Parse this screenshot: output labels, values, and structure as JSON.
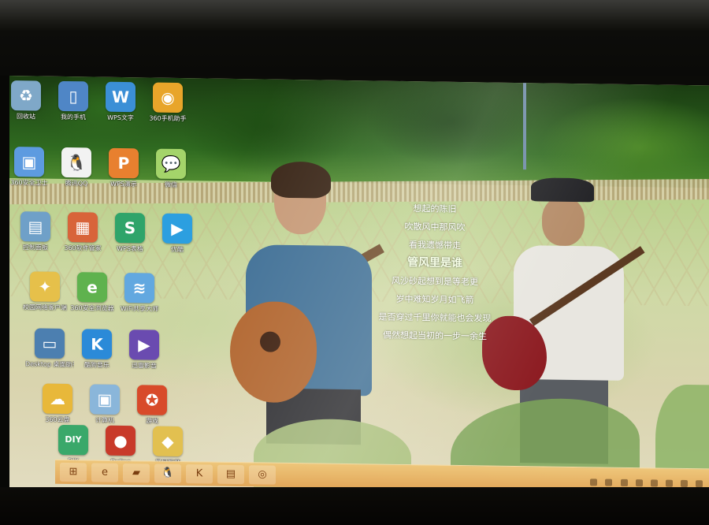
{
  "lyrics": [
    "想起的陈旧",
    "吹散风中那风吹",
    "看我遗憾带走",
    "管风里是谁",
    "风沙砂起想到是等老更",
    "岁中难知岁月如飞箭",
    "是否穿过千里你就能也会发现",
    "偶然想起当初的一步一余生"
  ],
  "desktop": {
    "icons": [
      {
        "label": "回收站",
        "color": "#7fa8c8",
        "glyph": "♻"
      },
      {
        "label": "我的手机",
        "color": "#4f86c6",
        "glyph": "▯"
      },
      {
        "label": "WPS文字",
        "color": "#3b8fd6",
        "glyph": "W"
      },
      {
        "label": "360手机助手",
        "color": "#e8a52a",
        "glyph": "◉"
      },
      {
        "label": "360安全卫士",
        "color": "#5d9be0",
        "glyph": "▣"
      },
      {
        "label": "腾讯QQ",
        "color": "#f2f2f2",
        "glyph": "🐧"
      },
      {
        "label": "WPS演示",
        "color": "#e8802f",
        "glyph": "P"
      },
      {
        "label": "微信",
        "color": "#a4d46a",
        "glyph": "💬"
      },
      {
        "label": "控制面板",
        "color": "#6fa0c8",
        "glyph": "▤"
      },
      {
        "label": "360软件管家",
        "color": "#d8643a",
        "glyph": "▦"
      },
      {
        "label": "WPS表格",
        "color": "#2fa46a",
        "glyph": "S"
      },
      {
        "label": "优酷",
        "color": "#2c9fe0",
        "glyph": "▶"
      },
      {
        "label": "校园网络客户端",
        "color": "#e6c04a",
        "glyph": "✦"
      },
      {
        "label": "360安全浏览器",
        "color": "#5fb24e",
        "glyph": "e"
      },
      {
        "label": "WiFi共享大师",
        "color": "#62a8e0",
        "glyph": "≋"
      },
      {
        "label": "Desktop 桌面助手",
        "color": "#4c7fb0",
        "glyph": "▭"
      },
      {
        "label": "酷狗音乐",
        "color": "#2b8ad8",
        "glyph": "K"
      },
      {
        "label": "迅雷影音",
        "color": "#6a4bb0",
        "glyph": "▶"
      },
      {
        "label": "360云盘",
        "color": "#e8b83a",
        "glyph": "☁"
      },
      {
        "label": "计算机",
        "color": "#8ab6da",
        "glyph": "▣"
      },
      {
        "label": "游戏",
        "color": "#d84a2a",
        "glyph": "✪"
      },
      {
        "label": "DIY",
        "color": "#3aa86a",
        "glyph": "DIY"
      },
      {
        "label": "Online",
        "color": "#c83a2a",
        "glyph": "●"
      },
      {
        "label": "暴风影音",
        "color": "#e2c050",
        "glyph": "◆"
      }
    ]
  },
  "taskbar": {
    "buttons": [
      {
        "name": "start-button",
        "glyph": "⊞"
      },
      {
        "name": "ie-button",
        "glyph": "e"
      },
      {
        "name": "explorer-button",
        "glyph": "▰"
      },
      {
        "name": "qq-button",
        "glyph": "🐧"
      },
      {
        "name": "kugou-button",
        "glyph": "K"
      },
      {
        "name": "folder-button",
        "glyph": "▤"
      },
      {
        "name": "browser-button",
        "glyph": "◎"
      }
    ]
  }
}
